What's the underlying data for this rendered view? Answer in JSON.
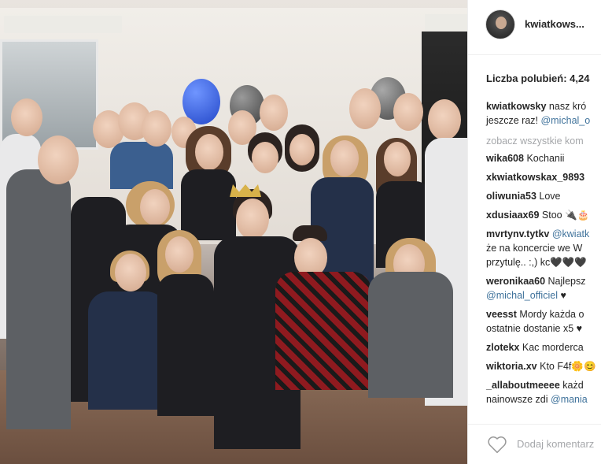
{
  "post": {
    "username": "kwiatkows...",
    "likes": "Liczba polubień: 4,24",
    "add_comment_placeholder": "Dodaj komentarz"
  },
  "caption": {
    "user": "kwiatkowsky",
    "line1_text": "nasz kró",
    "line2_text": "jeszcze raz!",
    "line2_mention": "@michal_o"
  },
  "view_all": "zobacz wszystkie kom",
  "comments": [
    {
      "user": "wika608",
      "text": "Kochanii",
      "line2": ""
    },
    {
      "user": "xkwiatkowskax_9893",
      "text": "",
      "line2": ""
    },
    {
      "user": "oliwunia53",
      "text": "Love",
      "line2": ""
    },
    {
      "user": "xdusiaax69",
      "text": "Stoo 🔌🎂",
      "line2": ""
    },
    {
      "user": "mvrtynv.tytkv",
      "text": "",
      "mention": "@kwiatk",
      "line2": "że na koncercie we W",
      "line3": "przytulę.. :,) kc🖤🖤🖤"
    },
    {
      "user": "weronikaa60",
      "text": "Najlepsz",
      "line2_mention": "@michal_officiel",
      "line2": " ♥"
    },
    {
      "user": "veesst",
      "text": "Mordy każda o",
      "line2": "ostatnie dostanie x5 ♥"
    },
    {
      "user": "zlotekx",
      "text": "Kac morderca",
      "line2": ""
    },
    {
      "user": "wiktoria.xv",
      "text": "Kto F4f🌼😊",
      "line2": ""
    },
    {
      "user": "_allaboutmeeee",
      "text": "każd",
      "line2": "nainowsze zdi",
      "line2_mention": "@mania"
    }
  ]
}
